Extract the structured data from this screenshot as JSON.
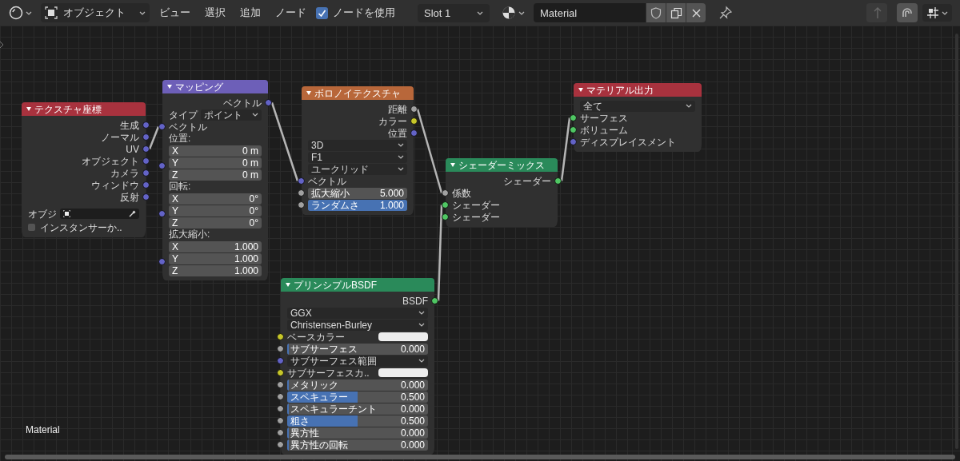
{
  "header": {
    "mode": "オブジェクト",
    "menus": [
      "ビュー",
      "選択",
      "追加",
      "ノード"
    ],
    "use_nodes": {
      "label": "ノードを使用",
      "checked": true
    },
    "slot": "Slot 1",
    "material": "Material",
    "snap": {
      "on": true
    }
  },
  "nodes": [
    {
      "title": "テクスチャ座標",
      "color": "#a8323e",
      "rows": [
        {
          "kind": "output",
          "label": "生成",
          "socket": {
            "color": "#6363c7"
          }
        },
        {
          "kind": "output",
          "label": "ノーマル",
          "socket": {
            "color": "#6363c7"
          }
        },
        {
          "kind": "output",
          "label": "UV",
          "socket": {
            "color": "#6363c7"
          }
        },
        {
          "kind": "output",
          "label": "オブジェクト",
          "socket": {
            "color": "#6363c7"
          }
        },
        {
          "kind": "output",
          "label": "カメラ",
          "socket": {
            "color": "#6363c7"
          }
        },
        {
          "kind": "output",
          "label": "ウィンドウ",
          "socket": {
            "color": "#6363c7"
          }
        },
        {
          "kind": "output",
          "label": "反射",
          "socket": {
            "color": "#6363c7"
          }
        },
        {
          "kind": "object",
          "label": "オブジ"
        },
        {
          "kind": "checkbox",
          "label": "インスタンサーか..",
          "checked": false
        }
      ]
    },
    {
      "title": "マッピング",
      "color": "#6d5fb8",
      "rows": [
        {
          "kind": "output",
          "label": "ベクトル",
          "socket": {
            "color": "#6363c7"
          }
        },
        {
          "kind": "dropdown",
          "label": "タイプ",
          "value": "ポイント"
        },
        {
          "kind": "input",
          "label": "ベクトル",
          "socket": {
            "color": "#6363c7"
          }
        },
        {
          "kind": "vector",
          "label": "位置:",
          "socket": {
            "color": "#6363c7"
          },
          "fields": [
            {
              "axis": "X",
              "value": "0 m"
            },
            {
              "axis": "Y",
              "value": "0 m"
            },
            {
              "axis": "Z",
              "value": "0 m"
            }
          ]
        },
        {
          "kind": "vector",
          "label": "回転:",
          "socket": {
            "color": "#6363c7"
          },
          "fields": [
            {
              "axis": "X",
              "value": "0°"
            },
            {
              "axis": "Y",
              "value": "0°"
            },
            {
              "axis": "Z",
              "value": "0°"
            }
          ]
        },
        {
          "kind": "vector",
          "label": "拡大縮小:",
          "socket": {
            "color": "#6363c7"
          },
          "fields": [
            {
              "axis": "X",
              "value": "1.000"
            },
            {
              "axis": "Y",
              "value": "1.000"
            },
            {
              "axis": "Z",
              "value": "1.000"
            }
          ]
        }
      ]
    },
    {
      "title": "ボロノイテクスチャ",
      "color": "#b8673a",
      "rows": [
        {
          "kind": "output",
          "label": "距離",
          "socket": {
            "color": "#a1a1a1"
          }
        },
        {
          "kind": "output",
          "label": "カラー",
          "socket": {
            "color": "#c7c729"
          }
        },
        {
          "kind": "output",
          "label": "位置",
          "socket": {
            "color": "#6363c7"
          }
        },
        {
          "kind": "dropdown",
          "value": "3D"
        },
        {
          "kind": "dropdown",
          "value": "F1"
        },
        {
          "kind": "dropdown",
          "value": "ユークリッド"
        },
        {
          "kind": "input",
          "label": "ベクトル",
          "socket": {
            "color": "#6363c7"
          }
        },
        {
          "kind": "field",
          "label": "拡大縮小",
          "value": "5.000",
          "socket": {
            "color": "#a1a1a1"
          }
        },
        {
          "kind": "slider",
          "label": "ランダムさ",
          "value": "1.000",
          "socket": {
            "color": "#a1a1a1"
          },
          "level": 1
        }
      ]
    },
    {
      "title": "シェーダーミックス",
      "color": "#2a8a5a",
      "rows": [
        {
          "kind": "output",
          "label": "シェーダー",
          "socket": {
            "color": "#4fc763"
          }
        },
        {
          "kind": "input",
          "label": "係数",
          "socket": {
            "color": "#a1a1a1"
          }
        },
        {
          "kind": "input",
          "label": "シェーダー",
          "socket": {
            "color": "#4fc763"
          }
        },
        {
          "kind": "input",
          "label": "シェーダー",
          "socket": {
            "color": "#4fc763"
          }
        }
      ]
    },
    {
      "title": "マテリアル出力",
      "color": "#a8323e",
      "rows": [
        {
          "kind": "dropdown",
          "value": "全て"
        },
        {
          "kind": "input",
          "label": "サーフェス",
          "socket": {
            "color": "#4fc763"
          }
        },
        {
          "kind": "input",
          "label": "ボリューム",
          "socket": {
            "color": "#4fc763"
          }
        },
        {
          "kind": "input",
          "label": "ディスプレイスメント",
          "socket": {
            "color": "#6363c7"
          }
        }
      ]
    },
    {
      "title": "プリンシプルBSDF",
      "color": "#2a8a5a",
      "rows": [
        {
          "kind": "output",
          "label": "BSDF",
          "socket": {
            "color": "#4fc763"
          }
        },
        {
          "kind": "dropdown",
          "value": "GGX"
        },
        {
          "kind": "dropdown",
          "value": "Christensen-Burley"
        },
        {
          "kind": "color",
          "label": "ベースカラー",
          "socket": {
            "color": "#c7c729"
          },
          "color": "#eeeeee"
        },
        {
          "kind": "slider",
          "label": "サブサーフェス",
          "value": "0.000",
          "socket": {
            "color": "#a1a1a1"
          },
          "level": 0
        },
        {
          "kind": "dropdown",
          "value": "サブサーフェス範囲",
          "socket": {
            "color": "#6363c7"
          }
        },
        {
          "kind": "color",
          "label": "サブサーフェスカ..",
          "socket": {
            "color": "#c7c729"
          },
          "color": "#eeeeee"
        },
        {
          "kind": "slider",
          "label": "メタリック",
          "value": "0.000",
          "socket": {
            "color": "#a1a1a1"
          },
          "level": 0
        },
        {
          "kind": "slider",
          "label": "スペキュラー",
          "value": "0.500",
          "socket": {
            "color": "#a1a1a1"
          },
          "level": 0.5
        },
        {
          "kind": "slider",
          "label": "スペキュラーチント",
          "value": "0.000",
          "socket": {
            "color": "#a1a1a1"
          },
          "level": 0
        },
        {
          "kind": "slider",
          "label": "粗さ",
          "value": "0.500",
          "socket": {
            "color": "#a1a1a1"
          },
          "level": 0.5
        },
        {
          "kind": "slider",
          "label": "異方性",
          "value": "0.000",
          "socket": {
            "color": "#a1a1a1"
          },
          "level": 0
        },
        {
          "kind": "slider",
          "label": "異方性の回転",
          "value": "0.000",
          "socket": {
            "color": "#a1a1a1"
          },
          "level": 0
        }
      ]
    }
  ],
  "canvas_label": "Material"
}
